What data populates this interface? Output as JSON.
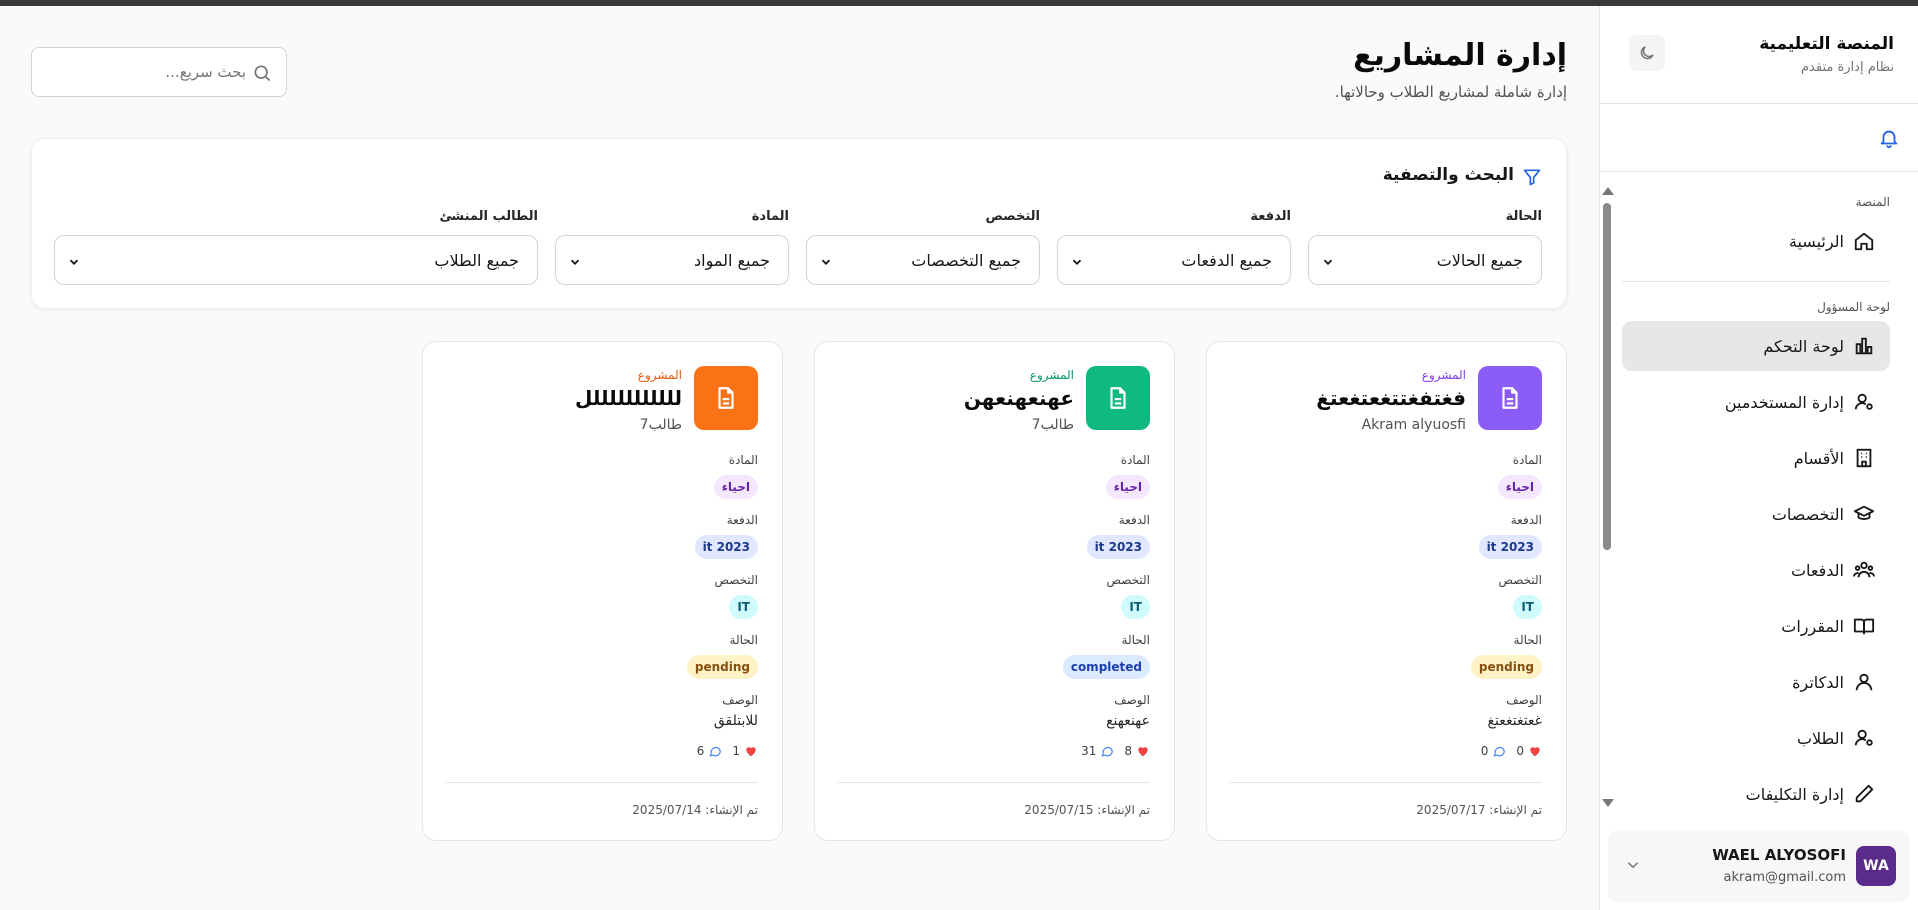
{
  "app": {
    "brand_title": "المنصة التعليمية",
    "brand_subtitle": "نظام إدارة متقدم"
  },
  "sidebar": {
    "group_platform": "المنصة",
    "group_admin": "لوحة المسؤول",
    "items": [
      {
        "label": "الرئيسية",
        "icon": "home-icon"
      },
      {
        "label": "لوحة التحكم",
        "icon": "bar-chart-icon"
      },
      {
        "label": "إدارة المستخدمين",
        "icon": "user-cog-icon"
      },
      {
        "label": "الأقسام",
        "icon": "building-icon"
      },
      {
        "label": "التخصصات",
        "icon": "graduation-cap-icon"
      },
      {
        "label": "الدفعات",
        "icon": "users-group-icon"
      },
      {
        "label": "المقررات",
        "icon": "book-icon"
      },
      {
        "label": "الدكاترة",
        "icon": "user-icon"
      },
      {
        "label": "الطلاب",
        "icon": "user-cog-icon"
      },
      {
        "label": "إدارة التكليفات",
        "icon": "pencil-icon"
      }
    ],
    "user": {
      "initials": "WA",
      "name": "WAEL ALYOSOFI",
      "email": "akram@gmail.com"
    }
  },
  "header": {
    "title": "إدارة المشاريع",
    "subtitle": "إدارة شاملة لمشاريع الطلاب وحالاتها.",
    "search_placeholder": "بحث سريع..."
  },
  "filters": {
    "title": "البحث والتصفية",
    "fields": [
      {
        "label": "الحالة",
        "value": "جميع الحالات"
      },
      {
        "label": "الدفعة",
        "value": "جميع الدفعات"
      },
      {
        "label": "التخصص",
        "value": "جميع التخصصات"
      },
      {
        "label": "المادة",
        "value": "جميع المواد"
      },
      {
        "label": "الطالب المنشئ",
        "value": "جميع الطلاب"
      }
    ]
  },
  "card_labels": {
    "kicker": "المشروع",
    "subject": "المادة",
    "batch": "الدفعة",
    "specialization": "التخصص",
    "status": "الحالة",
    "description": "الوصف"
  },
  "projects": [
    {
      "title": "فغتفغتتغعتغعتغ",
      "owner": "Akram alyuosfi",
      "subject": "احياء",
      "batch": "it 2023",
      "specialization": "IT",
      "status": "pending",
      "description": "غعتغتغعتغ",
      "likes": "0",
      "comments": "0",
      "created": "تم الإنشاء: 2025/07/17",
      "accent": "#8b5cf6",
      "kicker_color": "#7c3aed"
    },
    {
      "title": "عهنعهنعهن",
      "owner": "طالب7",
      "subject": "احياء",
      "batch": "it 2023",
      "specialization": "IT",
      "status": "completed",
      "description": "عهنعهنع",
      "likes": "8",
      "comments": "31",
      "created": "تم الإنشاء: 2025/07/15",
      "accent": "#10b981",
      "kicker_color": "#059669"
    },
    {
      "title": "لللللللللللل",
      "owner": "طالب7",
      "subject": "احياء",
      "batch": "it 2023",
      "specialization": "IT",
      "status": "pending",
      "description": "للابتلقق",
      "likes": "1",
      "comments": "6",
      "created": "تم الإنشاء: 2025/07/14",
      "accent": "#f97316",
      "kicker_color": "#ea580c"
    }
  ]
}
